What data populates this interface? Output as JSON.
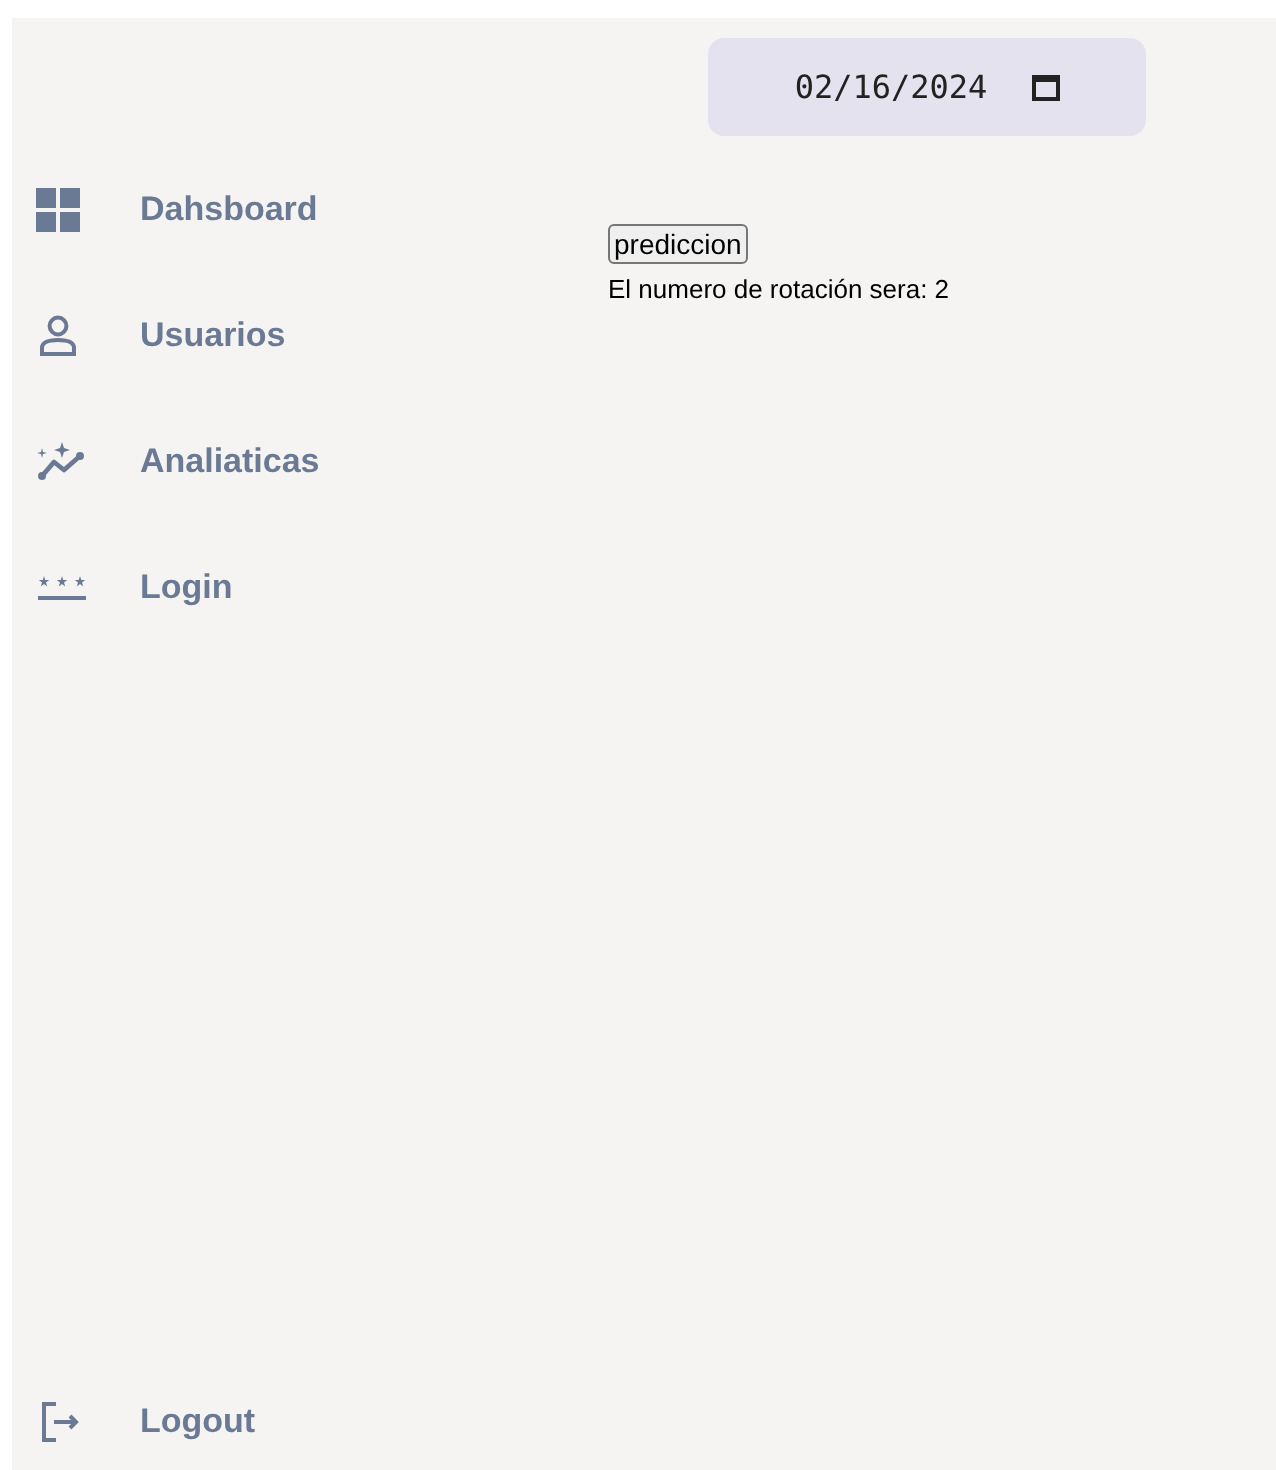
{
  "date_field": {
    "value": "02/16/2024"
  },
  "sidebar": {
    "items": [
      {
        "label": "Dahsboard"
      },
      {
        "label": "Usuarios"
      },
      {
        "label": "Analiaticas"
      },
      {
        "label": "Login"
      }
    ],
    "logout": {
      "label": "Logout"
    }
  },
  "prediction_button": {
    "label": "prediccion"
  },
  "result_text": "El numero de rotación sera: 2"
}
